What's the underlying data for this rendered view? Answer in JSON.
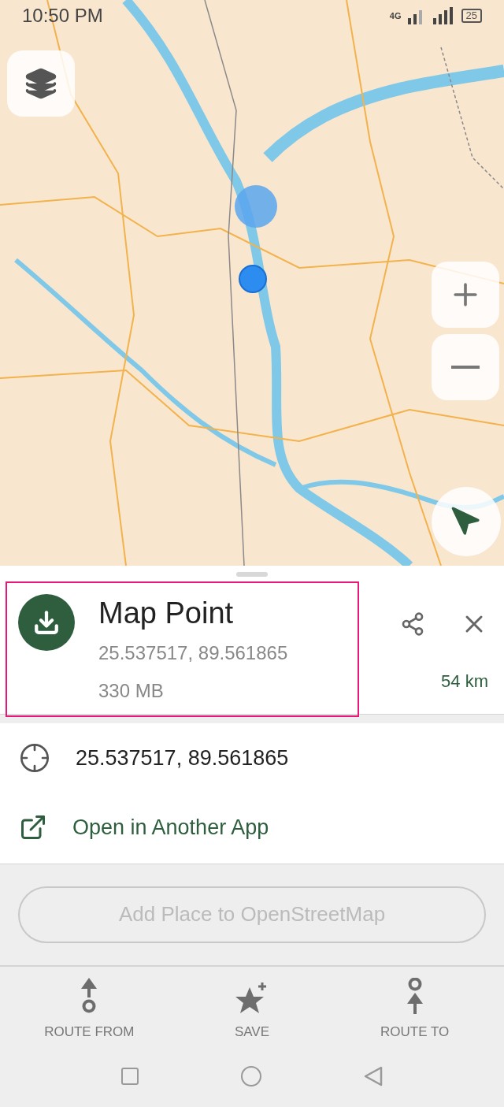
{
  "status_bar": {
    "time": "10:50 PM",
    "network": "4G",
    "battery": "25"
  },
  "point": {
    "title": "Map Point",
    "coordinates": "25.537517, 89.561865",
    "size": "330 MB",
    "distance": "54 km"
  },
  "details": [
    {
      "kind": "coordinates",
      "text": "25.537517, 89.561865"
    },
    {
      "kind": "link",
      "text": "Open in Another App"
    }
  ],
  "osm_button": {
    "label": "Add Place to OpenStreetMap",
    "disabled": true
  },
  "actions": [
    {
      "kind": "route_from",
      "label": "ROUTE FROM"
    },
    {
      "kind": "save",
      "label": "SAVE"
    },
    {
      "kind": "route_to",
      "label": "ROUTE TO"
    }
  ]
}
